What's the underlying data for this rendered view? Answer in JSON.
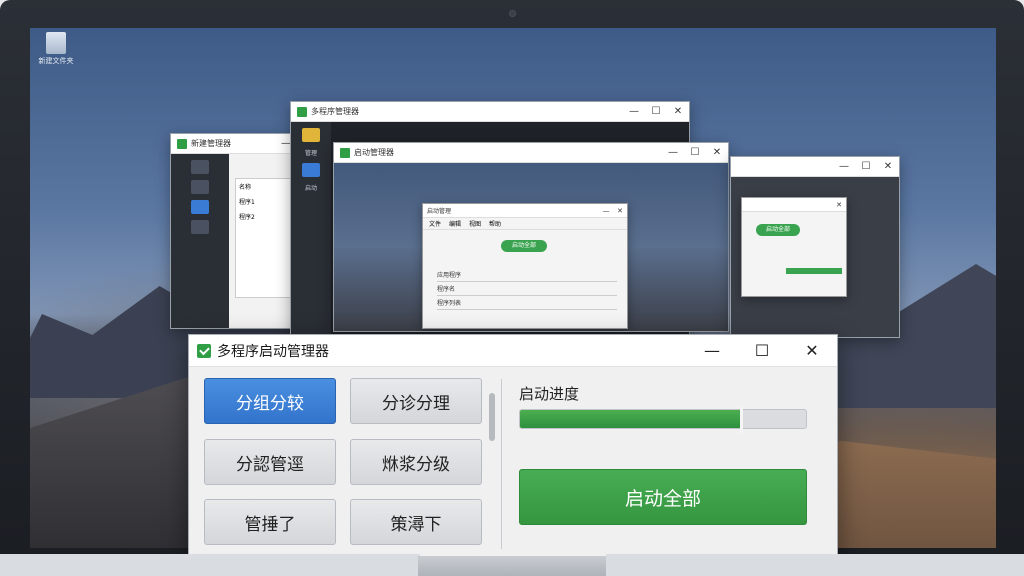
{
  "desktop": {
    "icon_label": "新建文件夹"
  },
  "bg_windows": {
    "w1_title": "新建管理器",
    "w1_items": [
      "名称",
      "程序1",
      "程序2"
    ],
    "w2_title": "多程序管理器",
    "w2_side": [
      "管理",
      "启动"
    ],
    "w3_title": "启动管理器",
    "w3_inner_title": "启动管理",
    "w3_inner_toolbar": [
      "文件",
      "编辑",
      "视图",
      "帮助"
    ],
    "w3_inner_pill": "启动全部",
    "w3_inner_rows": [
      "应用程序",
      "程序名",
      "程序列表"
    ],
    "w4_pill": "启动全部"
  },
  "main": {
    "title": "多程序启动管理器",
    "controls": {
      "minimize": "—",
      "maximize": "☐",
      "close": "✕"
    },
    "buttons": [
      {
        "label": "分组分较",
        "active": true
      },
      {
        "label": "分诊分理",
        "active": false
      },
      {
        "label": "分認管逕",
        "active": false
      },
      {
        "label": "烌浆分级",
        "active": false
      },
      {
        "label": "管捶了",
        "active": false
      },
      {
        "label": "策潯下",
        "active": false
      }
    ],
    "progress_label": "启动进度",
    "progress_fraction": 0.77,
    "launch_label": "启动全部"
  },
  "colors": {
    "accent_blue": "#3a80d6",
    "accent_green": "#3aa34f"
  }
}
